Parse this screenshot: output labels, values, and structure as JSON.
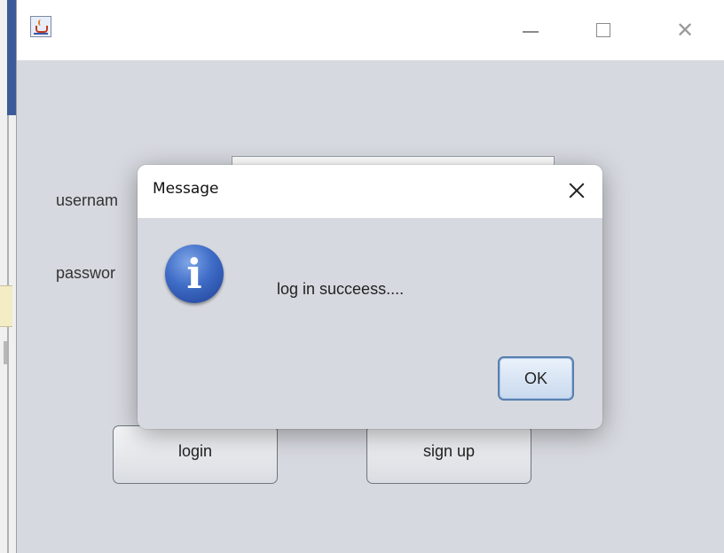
{
  "window": {
    "title_icon": "java-cup-icon",
    "controls": {
      "minimize": "minimize-icon",
      "maximize": "maximize-icon",
      "close": "close-icon",
      "close_glyph": "✕"
    }
  },
  "form": {
    "username_label": "usernam",
    "password_label": "passwor",
    "login_button": "login",
    "signup_button": "sign up"
  },
  "dialog": {
    "title": "Message",
    "message": "log in succeess....",
    "icon": "info-icon",
    "ok_button": "OK"
  },
  "colors": {
    "window_bg": "#d6d9df",
    "dialog_bg": "#d6d9df",
    "titlebar_bg": "#ffffff",
    "info_blue": "#3e6cc6"
  }
}
